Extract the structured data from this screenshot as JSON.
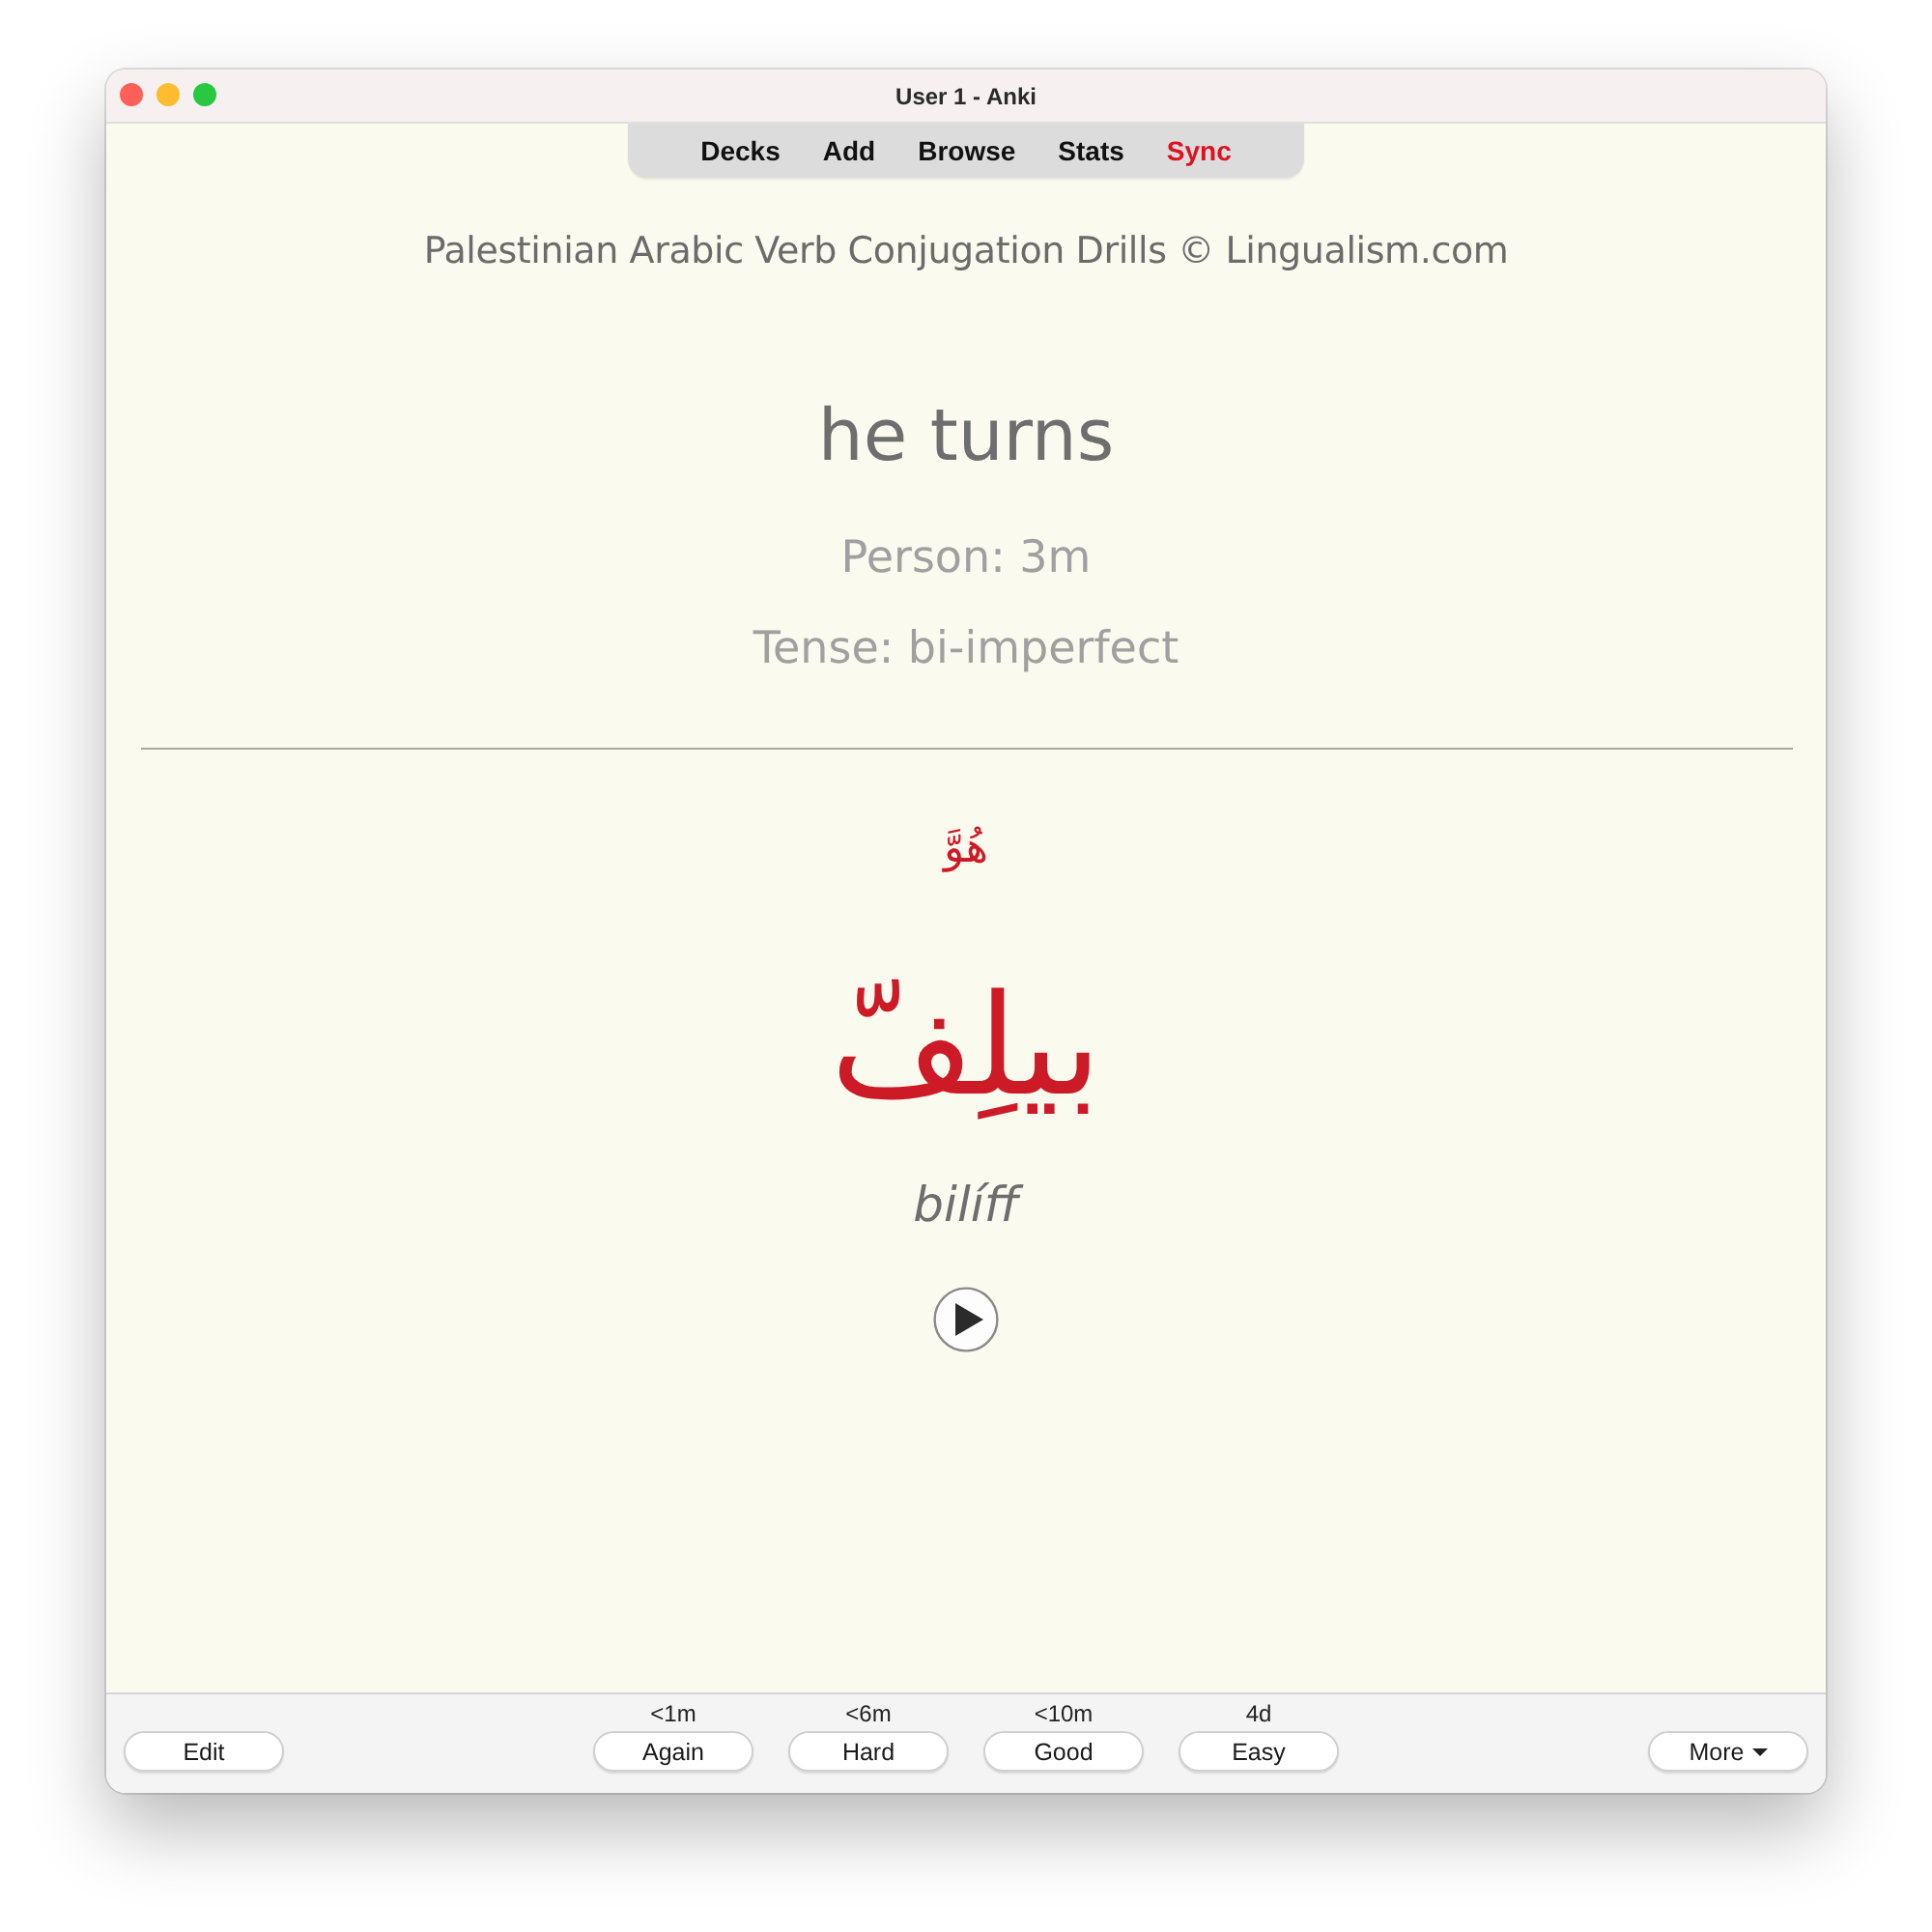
{
  "window": {
    "title": "User 1 - Anki"
  },
  "toolbar": [
    {
      "label": "Decks",
      "alert": false
    },
    {
      "label": "Add",
      "alert": false
    },
    {
      "label": "Browse",
      "alert": false
    },
    {
      "label": "Stats",
      "alert": false
    },
    {
      "label": "Sync",
      "alert": true
    }
  ],
  "card": {
    "deck_title": "Palestinian Arabic Verb Conjugation Drills © Lingualism.com",
    "front": "he turns",
    "person": "Person: 3m",
    "tense": "Tense: bi-imperfect",
    "pronoun": "هُوَّ",
    "verb": "بيلِفّ",
    "transliteration": "bilíff"
  },
  "bottom_bar": {
    "edit": "Edit",
    "answers": [
      {
        "interval": "<1m",
        "label": "Again"
      },
      {
        "interval": "<6m",
        "label": "Hard"
      },
      {
        "interval": "<10m",
        "label": "Good"
      },
      {
        "interval": "4d",
        "label": "Easy"
      }
    ],
    "more": "More"
  }
}
